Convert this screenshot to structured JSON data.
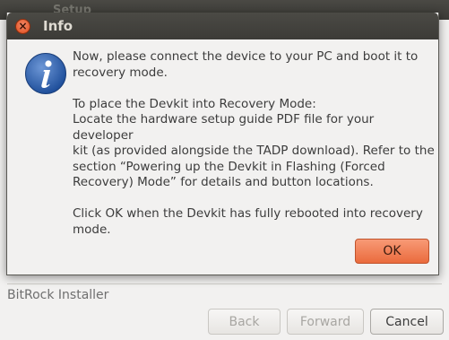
{
  "background_window": {
    "title": "Setup",
    "brand": "BitRock Installer",
    "buttons": {
      "back": "Back",
      "forward": "Forward",
      "cancel": "Cancel"
    }
  },
  "dialog": {
    "title": "Info",
    "icon": "info-icon",
    "paragraphs": [
      "Now, please connect the device to your PC and boot it to\nrecovery mode.",
      "To place the Devkit into Recovery Mode:\nLocate the hardware setup guide PDF file for your developer\nkit (as provided alongside the TADP download). Refer to the\nsection “Powering up the Devkit in Flashing (Forced\nRecovery) Mode” for details and button locations.",
      "Click OK when the Devkit has fully rebooted into recovery\nmode."
    ],
    "ok_label": "OK"
  },
  "colors": {
    "accent": "#ea6b3d",
    "titlebar": "#3c3b37",
    "info_icon": "#2a5ca8"
  }
}
